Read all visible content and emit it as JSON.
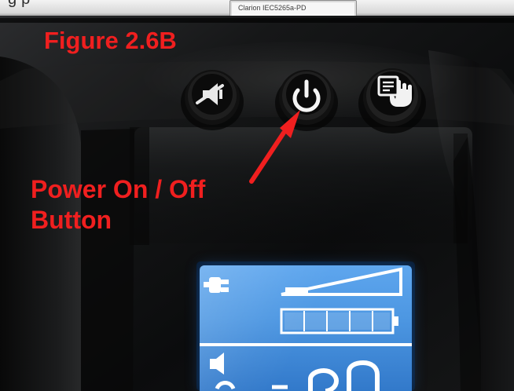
{
  "image": {
    "top_partial_text": "g p",
    "label_plate_text": "Clarion  IEC5265a-PD",
    "figure_label": "Figure 2.6B",
    "callout_label": "Power On / Off\nButton",
    "colors": {
      "annotation_red": "#f01f1f",
      "display_blue": "#4d97e2",
      "device_black": "#121314"
    },
    "buttons": [
      {
        "name": "mute",
        "icon": "mute-speaker-icon"
      },
      {
        "name": "power",
        "icon": "power-icon"
      },
      {
        "name": "menu",
        "icon": "menu-hand-icon"
      }
    ],
    "display": {
      "icons": [
        "ac-plug-icon",
        "load-bar-icon",
        "battery-icon",
        "speaker-icon",
        "partial-digits"
      ]
    }
  }
}
